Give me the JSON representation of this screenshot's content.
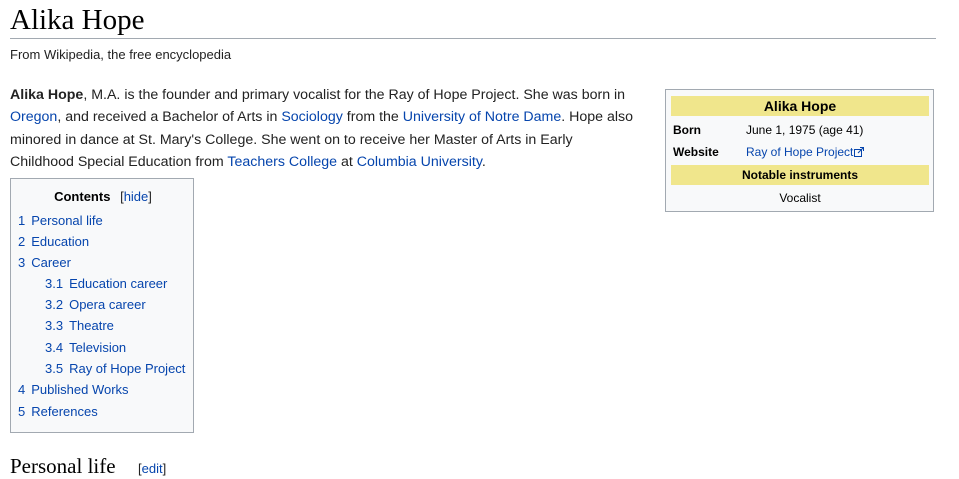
{
  "article": {
    "title": "Alika Hope",
    "tagline": "From Wikipedia, the free encyclopedia"
  },
  "lead": [
    {
      "t": "Alika Hope",
      "bold": true
    },
    {
      "t": ", M.A. is the founder and primary vocalist for the Ray of Hope Project. She was born in "
    },
    {
      "t": "Oregon",
      "link": true
    },
    {
      "t": ", and received a Bachelor of Arts in "
    },
    {
      "t": "Sociology",
      "link": true
    },
    {
      "t": " from the "
    },
    {
      "t": "University of Notre Dame",
      "link": true
    },
    {
      "t": ". Hope also minored in dance at St. Mary's College. She went on to receive her Master of Arts in Early Childhood Special Education from "
    },
    {
      "t": "Teachers College",
      "link": true
    },
    {
      "t": " at "
    },
    {
      "t": "Columbia University",
      "link": true
    },
    {
      "t": "."
    }
  ],
  "infobox": {
    "title": "Alika Hope",
    "born_label": "Born",
    "born_value": "June 1, 1975 (age 41)",
    "website_label": "Website",
    "website_value": "Ray of Hope Project",
    "section_label": "Notable instruments",
    "instrument": "Vocalist"
  },
  "toc": {
    "title": "Contents",
    "bracket_open": "[",
    "hide_label": "hide",
    "bracket_close": "]",
    "items": [
      {
        "num": "1",
        "label": "Personal life",
        "level": 1
      },
      {
        "num": "2",
        "label": "Education",
        "level": 1
      },
      {
        "num": "3",
        "label": "Career",
        "level": 1
      },
      {
        "num": "3.1",
        "label": "Education career",
        "level": 2
      },
      {
        "num": "3.2",
        "label": "Opera career",
        "level": 2
      },
      {
        "num": "3.3",
        "label": "Theatre",
        "level": 2
      },
      {
        "num": "3.4",
        "label": "Television",
        "level": 2
      },
      {
        "num": "3.5",
        "label": "Ray of Hope Project",
        "level": 2
      },
      {
        "num": "4",
        "label": "Published Works",
        "level": 1
      },
      {
        "num": "5",
        "label": "References",
        "level": 1
      }
    ]
  },
  "section": {
    "heading": "Personal life",
    "edit_open": "[",
    "edit_label": "edit",
    "edit_close": "]"
  },
  "colors": {
    "link": "#0645ad",
    "infobox_header": "#f0e68c",
    "border": "#a2a9b1",
    "panel_bg": "#f8f9fa"
  }
}
